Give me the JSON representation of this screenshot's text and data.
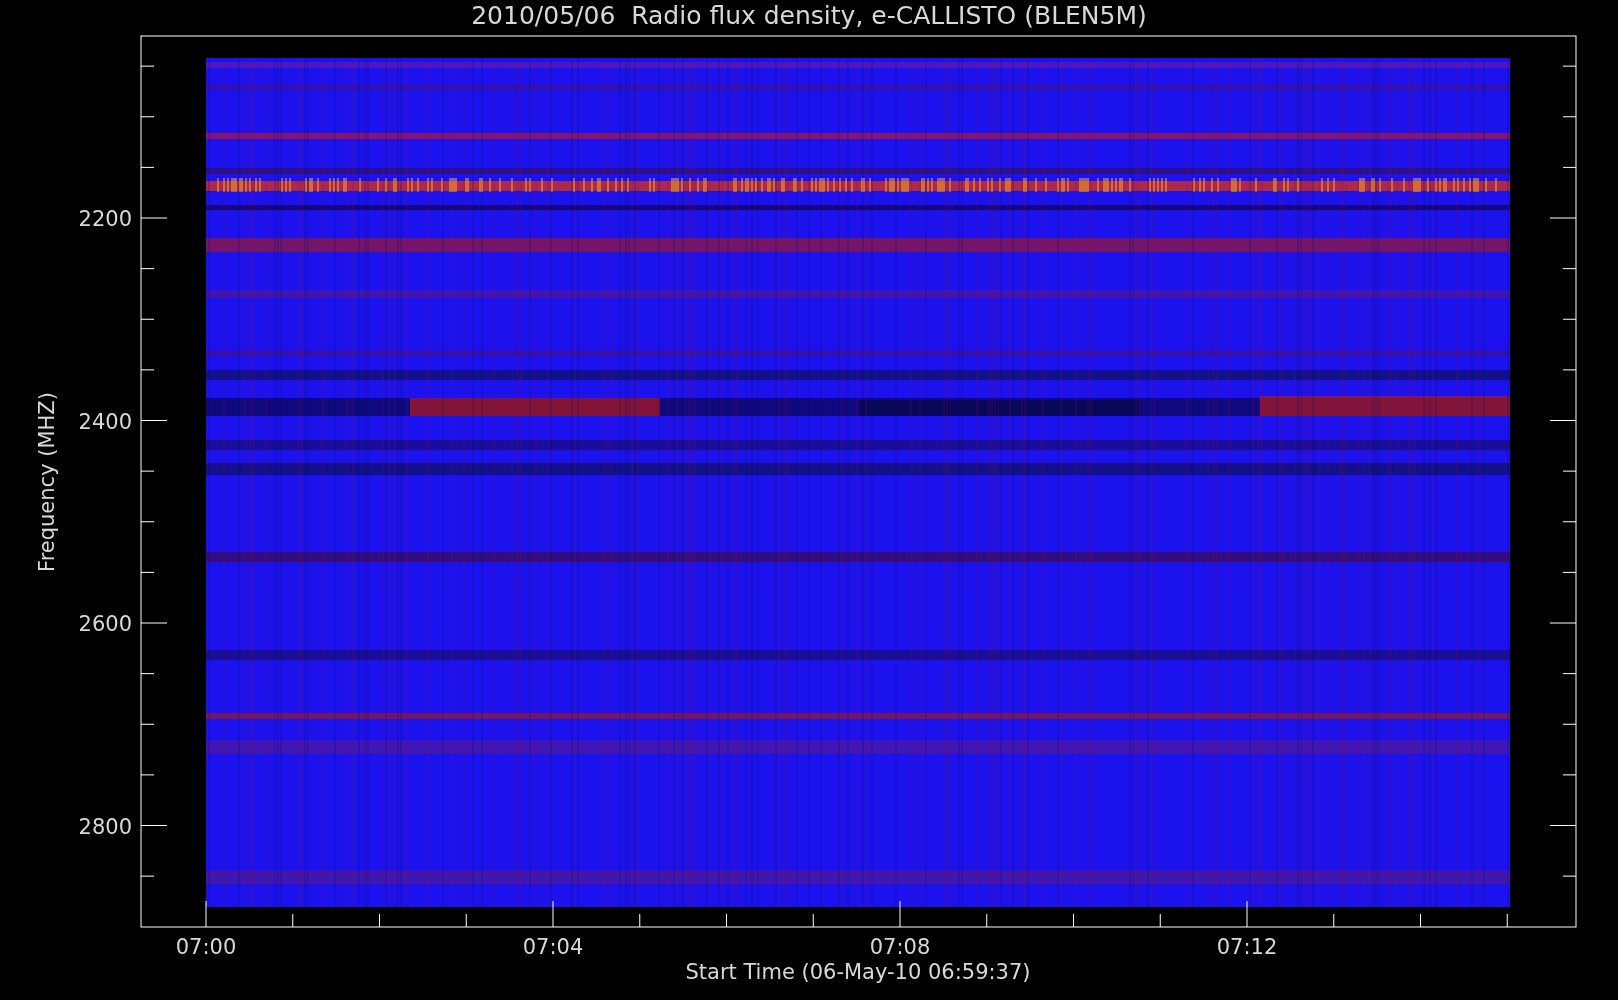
{
  "title": "2010/05/06  Radio flux density, e-CALLISTO (BLEN5M)",
  "y_axis": {
    "label": "Frequency (MHZ)",
    "ticks": [
      "2200",
      "2400",
      "2600",
      "2800"
    ]
  },
  "x_axis": {
    "label": "Start Time (06-May-10 06:59:37)",
    "ticks": [
      "07:00",
      "07:04",
      "07:08",
      "07:12"
    ]
  }
}
